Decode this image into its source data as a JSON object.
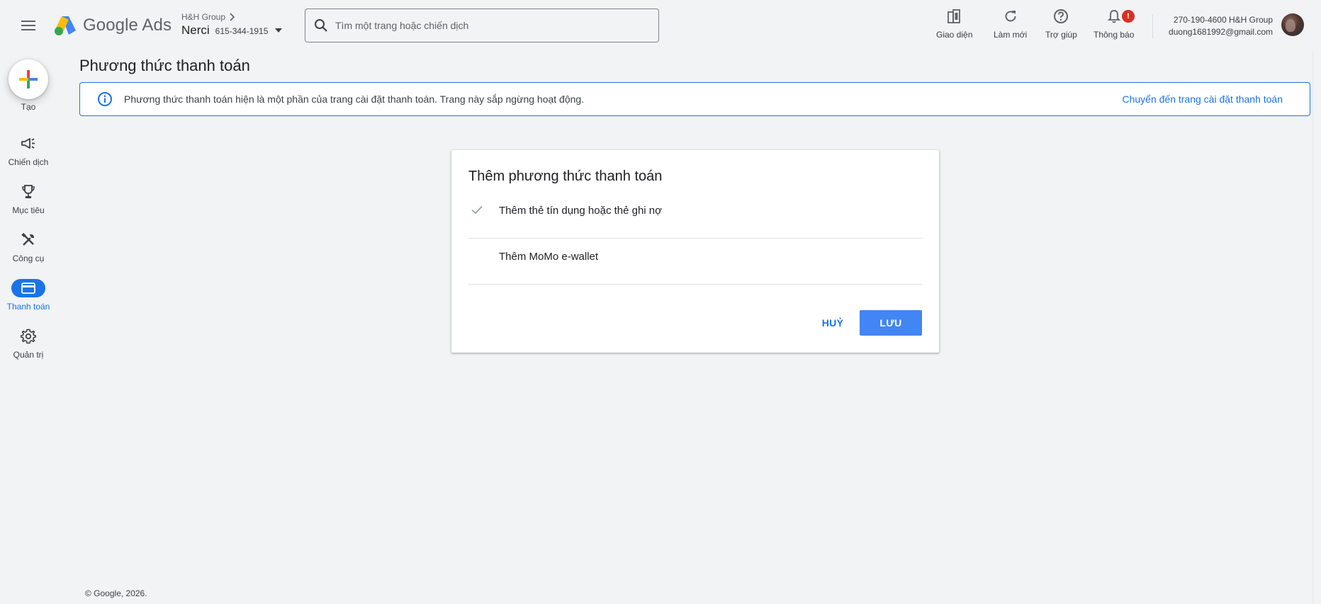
{
  "header": {
    "logo_text": "Google Ads",
    "account": {
      "group": "H&H Group",
      "name": "Nerci",
      "id": "615-344-1915"
    },
    "search": {
      "placeholder": "Tìm một trang hoặc chiến dịch"
    },
    "tools": [
      {
        "label": "Giao diện",
        "icon": "appearance-icon"
      },
      {
        "label": "Làm mới",
        "icon": "refresh-icon"
      },
      {
        "label": "Trợ giúp",
        "icon": "help-icon"
      },
      {
        "label": "Thông báo",
        "icon": "bell-icon",
        "badge": "!"
      }
    ],
    "user": {
      "line1": "270-190-4600 H&H Group",
      "email": "duong1681992@gmail.com"
    }
  },
  "sidebar": {
    "create_label": "Tạo",
    "items": [
      {
        "label": "Chiến dịch",
        "icon": "campaign-icon",
        "active": false
      },
      {
        "label": "Mục tiêu",
        "icon": "trophy-icon",
        "active": false
      },
      {
        "label": "Công cụ",
        "icon": "tools-icon",
        "active": false
      },
      {
        "label": "Thanh toán",
        "icon": "credit-card-icon",
        "active": true
      },
      {
        "label": "Quản trị",
        "icon": "gear-icon",
        "active": false
      }
    ]
  },
  "main": {
    "title": "Phương thức thanh toán",
    "banner": {
      "text": "Phương thức thanh toán hiện là một phần của trang cài đặt thanh toán. Trang này sắp ngừng hoạt động.",
      "link": "Chuyển đến trang cài đặt thanh toán"
    },
    "dialog": {
      "title": "Thêm phương thức thanh toán",
      "options": [
        {
          "label": "Thêm thẻ tín dụng hoặc thẻ ghi nợ",
          "checked": true
        },
        {
          "label": "Thêm MoMo e-wallet",
          "checked": false
        }
      ],
      "cancel_label": "HUỶ",
      "save_label": "LƯU"
    }
  },
  "footer": {
    "text": "© Google, 2026."
  },
  "colors": {
    "accent": "#1a73e8",
    "primary_button": "#4285f4",
    "badge": "#d93025",
    "background": "#f1f3f4"
  }
}
